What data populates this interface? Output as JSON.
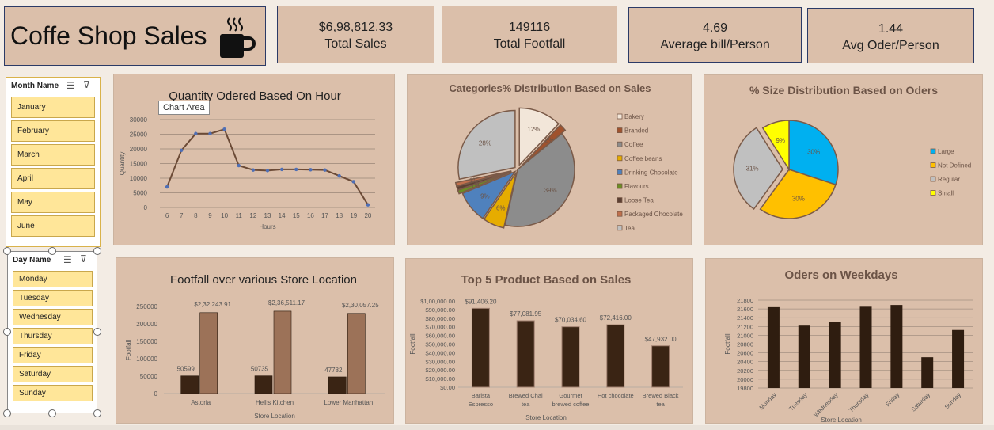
{
  "header": {
    "title": "Coffe Shop Sales"
  },
  "kpis": [
    {
      "value": "$6,98,812.33",
      "label": "Total Sales"
    },
    {
      "value": "149116",
      "label": "Total Footfall"
    },
    {
      "value": "4.69",
      "label": "Average bill/Person"
    },
    {
      "value": "1.44",
      "label": "Avg Oder/Person"
    }
  ],
  "slicers": {
    "month": {
      "title": "Month Name",
      "items": [
        "January",
        "February",
        "March",
        "April",
        "May",
        "June"
      ]
    },
    "day": {
      "title": "Day Name",
      "items": [
        "Monday",
        "Tuesday",
        "Wednesday",
        "Thursday",
        "Friday",
        "Saturday",
        "Sunday"
      ]
    }
  },
  "tooltip": "Chart Area",
  "chart_data": [
    {
      "type": "line",
      "title": "Quantity Odered Based On Hour",
      "xlabel": "Hours",
      "ylabel": "Quantity",
      "x": [
        6,
        7,
        8,
        9,
        10,
        11,
        12,
        13,
        14,
        15,
        16,
        17,
        18,
        19,
        20
      ],
      "values": [
        7000,
        19500,
        25200,
        25200,
        26700,
        14300,
        12800,
        12600,
        13000,
        13000,
        12900,
        12800,
        10800,
        8800,
        900
      ],
      "ylim": [
        0,
        30000
      ],
      "yticks": [
        "0",
        "5000",
        "10000",
        "15000",
        "20000",
        "25000",
        "30000"
      ],
      "grid": true
    },
    {
      "type": "pie",
      "title": "Categories% Distribution Based on Sales",
      "categories": [
        "Bakery",
        "Branded",
        "Coffee",
        "Coffee beans",
        "Drinking Chocolate",
        "Flavours",
        "Loose Tea",
        "Packaged Chocolate",
        "Tea"
      ],
      "values": [
        12,
        2,
        39,
        6,
        9,
        1,
        1,
        1,
        28
      ],
      "labels": [
        "12%",
        "2%",
        "39%",
        "6%",
        "9%",
        "1%",
        "1%",
        "1%",
        "28%"
      ],
      "colors": [
        "#f2e6d9",
        "#a0522d",
        "#8c8c8c",
        "#e6ac00",
        "#4f81bd",
        "#6b8e23",
        "#5c4033",
        "#c0704d",
        "#c0c0c0"
      ],
      "legend": "right"
    },
    {
      "type": "pie",
      "title": "% Size Distribution Based on Oders",
      "categories": [
        "Large",
        "Not Defined",
        "Regular",
        "Small"
      ],
      "values": [
        30,
        30,
        31,
        9
      ],
      "labels": [
        "30%",
        "30%",
        "31%",
        "9%"
      ],
      "colors": [
        "#00b0f0",
        "#ffc000",
        "#c0c0c0",
        "#ffff00"
      ],
      "legend": "right"
    },
    {
      "type": "bar",
      "title": "Footfall over various Store Location",
      "xlabel": "Store Location",
      "ylabel": "Footfall",
      "categories": [
        "Astoria",
        "Hell's Kitchen",
        "Lower Manhattan"
      ],
      "series": [
        {
          "values": [
            50599,
            50735,
            47782
          ],
          "labels": [
            "50599",
            "50735",
            "47782"
          ],
          "color": "#3a2414"
        },
        {
          "values": [
            232243.91,
            236511.17,
            230057.25
          ],
          "labels": [
            "$2,32,243.91",
            "$2,36,511.17",
            "$2,30,057.25"
          ],
          "color": "#9c7258"
        }
      ],
      "ylim": [
        0,
        250000
      ],
      "yticks": [
        "0",
        "50000",
        "100000",
        "150000",
        "200000",
        "250000"
      ]
    },
    {
      "type": "bar",
      "title": "Top 5 Product Based on Sales",
      "xlabel": "Store Location",
      "ylabel": "Footfall",
      "categories": [
        [
          "Barista",
          "Espresso"
        ],
        [
          "Brewed Chai",
          "tea"
        ],
        [
          "Gourmet",
          "brewed coffee"
        ],
        [
          "Hot chocolate"
        ],
        [
          "Brewed Black",
          "tea"
        ]
      ],
      "values": [
        91406.2,
        77081.95,
        70034.6,
        72416.0,
        47932.0
      ],
      "labels": [
        "$91,406.20",
        "$77,081.95",
        "$70,034.60",
        "$72,416.00",
        "$47,932.00"
      ],
      "ylim": [
        0,
        100000
      ],
      "yticks": [
        "$0.00",
        "$10,000.00",
        "$20,000.00",
        "$30,000.00",
        "$40,000.00",
        "$50,000.00",
        "$60,000.00",
        "$70,000.00",
        "$80,000.00",
        "$90,000.00",
        "$1,00,000.00"
      ]
    },
    {
      "type": "bar",
      "title": "Oders on Weekdays",
      "xlabel": "Store Location",
      "ylabel": "Footfall",
      "categories": [
        "Monday",
        "Tuesday",
        "Wednesday",
        "Thursday",
        "Friday",
        "Saturday",
        "Sunday"
      ],
      "values": [
        21640,
        21220,
        21310,
        21650,
        21690,
        20500,
        21120
      ],
      "ylim": [
        19800,
        21800
      ],
      "yticks": [
        "19800",
        "20000",
        "20200",
        "20400",
        "20600",
        "20800",
        "21000",
        "21200",
        "21400",
        "21600",
        "21800"
      ],
      "grid": true
    }
  ]
}
